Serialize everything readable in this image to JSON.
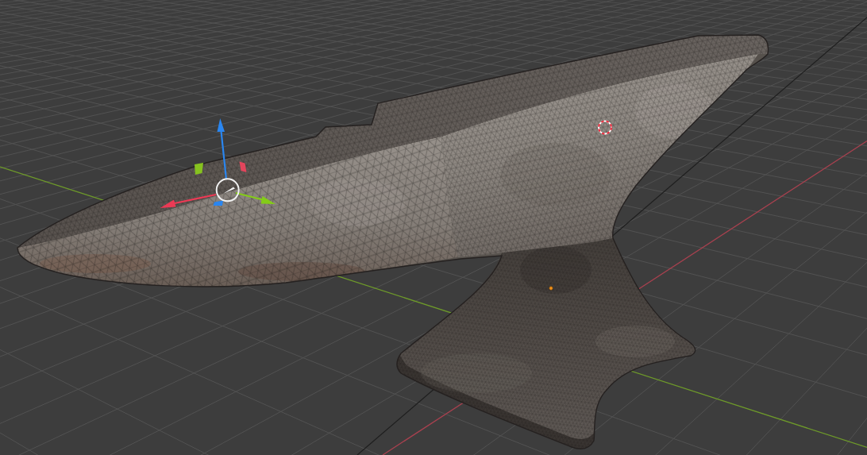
{
  "viewport": {
    "wireframe_overlay": true
  }
}
